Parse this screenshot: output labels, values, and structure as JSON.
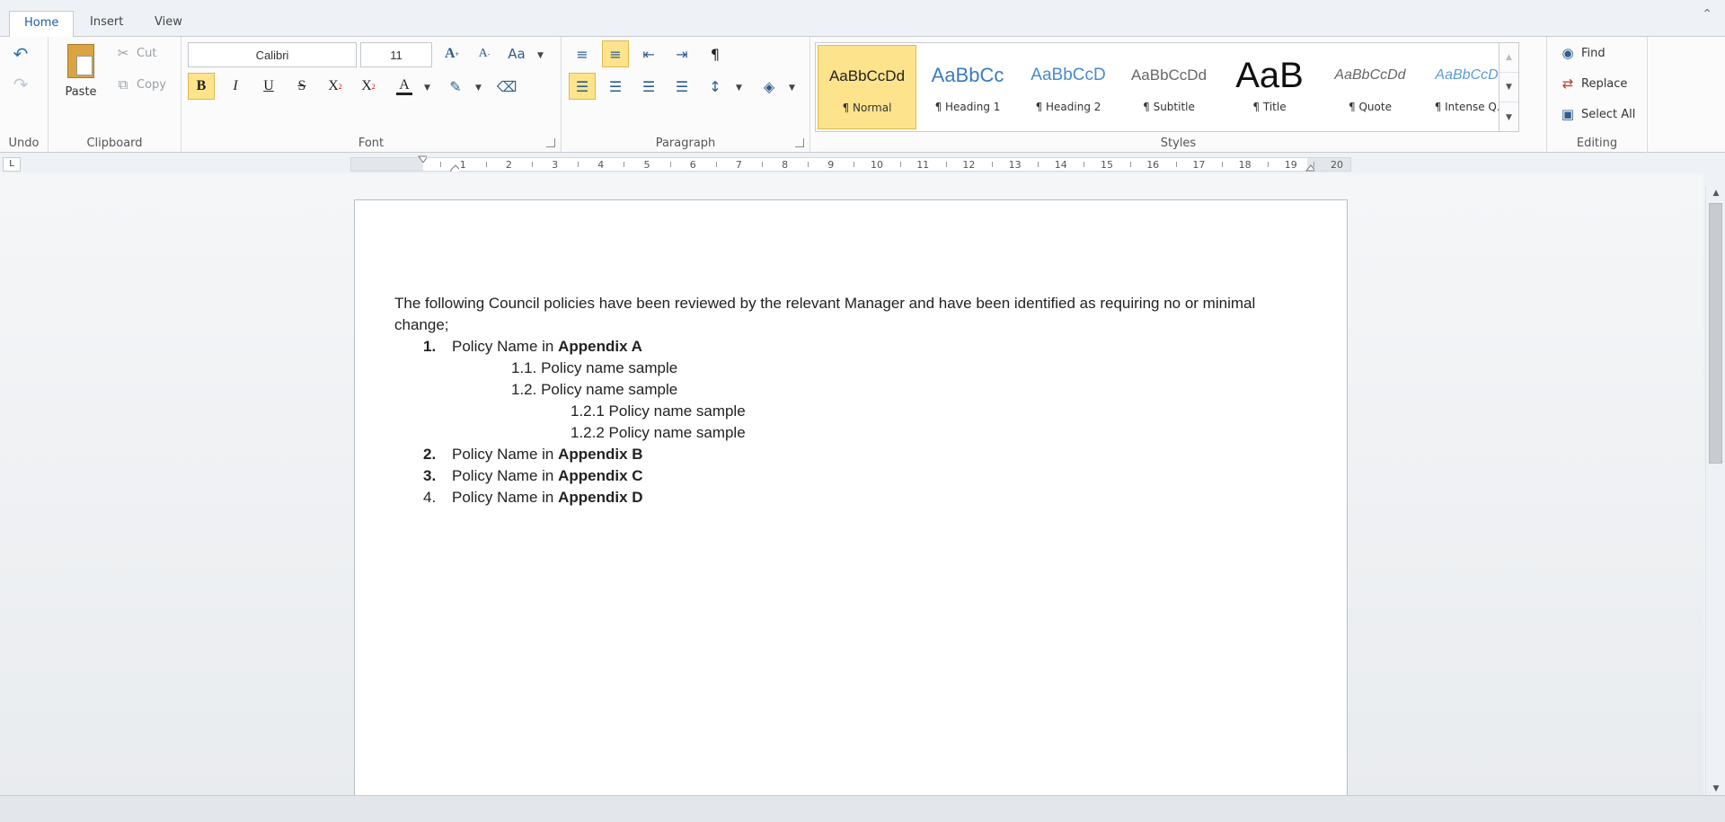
{
  "tabs": [
    "Home",
    "Insert",
    "View"
  ],
  "ribbon": {
    "undo_group_label": "Undo",
    "clipboard": {
      "group_label": "Clipboard",
      "paste_label": "Paste",
      "cut_label": "Cut",
      "copy_label": "Copy"
    },
    "font": {
      "group_label": "Font",
      "font_name": "Calibri",
      "font_size": "11"
    },
    "paragraph": {
      "group_label": "Paragraph"
    },
    "styles": {
      "group_label": "Styles",
      "items": [
        {
          "preview": "AaBbCcDd",
          "name": "¶ Normal"
        },
        {
          "preview": "AaBbCc",
          "name": "¶ Heading 1"
        },
        {
          "preview": "AaBbCcD",
          "name": "¶ Heading 2"
        },
        {
          "preview": "AaBbCcDd",
          "name": "¶ Subtitle"
        },
        {
          "preview": "AaB",
          "name": "¶ Title"
        },
        {
          "preview": "AaBbCcDd",
          "name": "¶ Quote"
        },
        {
          "preview": "AaBbCcDd",
          "name": "¶ Intense Q..."
        }
      ]
    },
    "editing": {
      "group_label": "Editing",
      "find_label": "Find",
      "replace_label": "Replace",
      "select_all_label": "Select All"
    }
  },
  "ruler": {
    "numbers": [
      "1",
      "2",
      "3",
      "4",
      "5",
      "6",
      "7",
      "8",
      "9",
      "10",
      "11",
      "12",
      "13",
      "14",
      "15",
      "16",
      "17",
      "18",
      "19",
      "20"
    ],
    "tab_selector": "L"
  },
  "document": {
    "intro": "The following Council policies have been reviewed by the relevant Manager and have been identified as requiring no or minimal change;",
    "items": [
      {
        "num": "1.",
        "num_bold": true,
        "text": "Policy Name in ",
        "bold_text": "Appendix A",
        "level": 1
      },
      {
        "num": "1.1.",
        "num_bold": false,
        "text": "Policy name sample",
        "bold_text": "",
        "level": 2
      },
      {
        "num": "1.2.",
        "num_bold": false,
        "text": "Policy name sample",
        "bold_text": "",
        "level": 2
      },
      {
        "num": "1.2.1",
        "num_bold": false,
        "text": "Policy name sample",
        "bold_text": "",
        "level": 3
      },
      {
        "num": "1.2.2",
        "num_bold": false,
        "text": "Policy name sample",
        "bold_text": "",
        "level": 3
      },
      {
        "num": "2.",
        "num_bold": true,
        "text": "Policy Name in ",
        "bold_text": "Appendix B",
        "level": 1
      },
      {
        "num": "3.",
        "num_bold": true,
        "text": "Policy Name in ",
        "bold_text": "Appendix C",
        "level": 1
      },
      {
        "num": "4.",
        "num_bold": false,
        "text": "Policy Name in ",
        "bold_text": "Appendix D",
        "level": 1
      }
    ]
  },
  "colors": {
    "accent": "#1e5e9e",
    "selected_fill": "#fde38c",
    "selected_border": "#e2b84a"
  }
}
